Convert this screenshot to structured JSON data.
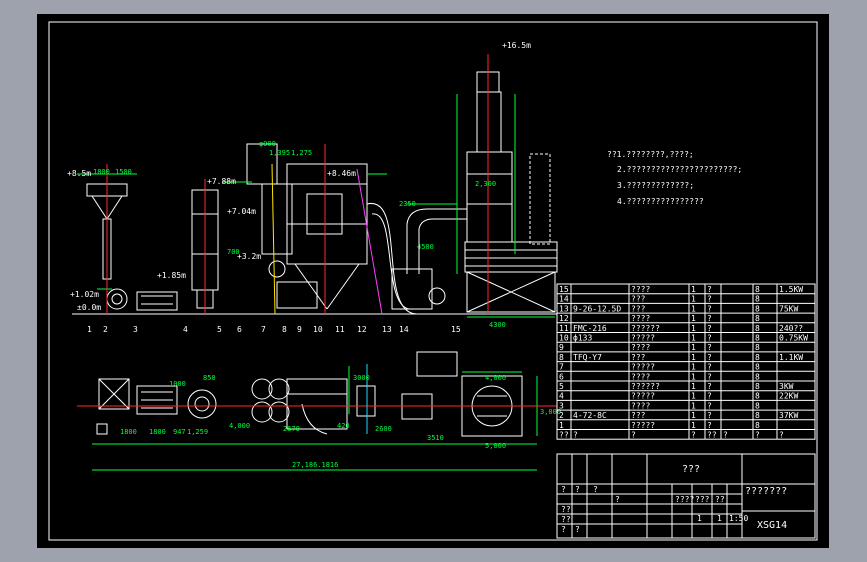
{
  "notes": {
    "title": "??1.????????,????;",
    "lines": [
      "2.???????????????????????;",
      "3.?????????????;",
      "4.????????????????"
    ]
  },
  "dims": {
    "top_elev": "+16.5m",
    "overall": "27,186.1816",
    "d1800a": "1800",
    "d1800b": "1800",
    "d947": "947",
    "d1259": "1,259",
    "d4000": "4,000",
    "d2670": "2670",
    "d420": "420",
    "d2600": "2600",
    "d3510": "3510",
    "d5000": "5,000",
    "d4000b": "4,000",
    "d3000": "3,000",
    "d850": "850",
    "d1000": "1000",
    "d3000b": "3000",
    "e85": "+8.5m",
    "e788": "+7.88m",
    "e846": "+8.46m",
    "e704": "+7.04m",
    "e32": "+3.2m",
    "e185": "+1.85m",
    "e102": "+1.02m",
    "e00": "±0.0m",
    "d2350": "2350",
    "d4500": "4500",
    "d4300": "4300",
    "d900": "φ900",
    "d1275": "1,275",
    "d1395": "1,395",
    "d2000": "2,000",
    "d1800c": "1800",
    "d1500": "1500",
    "d2300": "2,300",
    "d700": "700"
  },
  "labels": [
    "1",
    "2",
    "3",
    "4",
    "5",
    "6",
    "7",
    "8",
    "9",
    "10",
    "11",
    "12",
    "13",
    "14",
    "15"
  ],
  "parts_table": [
    {
      "no": "15",
      "spec": "",
      "name": "????",
      "qty": "1",
      "mat": "?",
      "note": "8",
      "power": "1.5KW"
    },
    {
      "no": "14",
      "spec": "",
      "name": "???",
      "qty": "1",
      "mat": "?",
      "note": "8",
      "power": ""
    },
    {
      "no": "13",
      "spec": "9-26-12.5D",
      "name": "???",
      "qty": "1",
      "mat": "?",
      "note": "8",
      "power": "75KW"
    },
    {
      "no": "12",
      "spec": "",
      "name": "????",
      "qty": "1",
      "mat": "?",
      "note": "8",
      "power": ""
    },
    {
      "no": "11",
      "spec": "FMC-216",
      "name": "??????",
      "qty": "1",
      "mat": "?",
      "note": "8",
      "power": "240??"
    },
    {
      "no": "10",
      "spec": "ф133",
      "name": "?????",
      "qty": "1",
      "mat": "?",
      "note": "8",
      "power": "0.75KW"
    },
    {
      "no": "9",
      "spec": "",
      "name": "????",
      "qty": "1",
      "mat": "?",
      "note": "8",
      "power": ""
    },
    {
      "no": "8",
      "spec": "TFQ-Y7",
      "name": "???",
      "qty": "1",
      "mat": "?",
      "note": "8",
      "power": "1.1KW"
    },
    {
      "no": "7",
      "spec": "",
      "name": "?????",
      "qty": "1",
      "mat": "?",
      "note": "8",
      "power": ""
    },
    {
      "no": "6",
      "spec": "",
      "name": "????",
      "qty": "1",
      "mat": "?",
      "note": "8",
      "power": ""
    },
    {
      "no": "5",
      "spec": "",
      "name": "??????",
      "qty": "1",
      "mat": "?",
      "note": "8",
      "power": "3KW"
    },
    {
      "no": "4",
      "spec": "",
      "name": "?????",
      "qty": "1",
      "mat": "?",
      "note": "8",
      "power": "22KW"
    },
    {
      "no": "3",
      "spec": "",
      "name": "????",
      "qty": "1",
      "mat": "?",
      "note": "8",
      "power": ""
    },
    {
      "no": "2",
      "spec": "4-72-8C",
      "name": "???",
      "qty": "1",
      "mat": "?",
      "note": "8",
      "power": "37KW"
    },
    {
      "no": "1",
      "spec": "",
      "name": "?????",
      "qty": "1",
      "mat": "?",
      "note": "8",
      "power": ""
    }
  ],
  "table_header": [
    "??",
    "?",
    "?",
    "?",
    "??",
    "?",
    "?",
    "?"
  ],
  "title_block": {
    "company": "???",
    "drawing_name": "???????",
    "scale": "1:50",
    "code": "XSG14",
    "sheet_a": "1",
    "sheet_b": "1",
    "small": [
      "?",
      "?",
      "?",
      "????",
      "???",
      "??",
      "?",
      "??",
      "??",
      "?",
      "?"
    ]
  }
}
